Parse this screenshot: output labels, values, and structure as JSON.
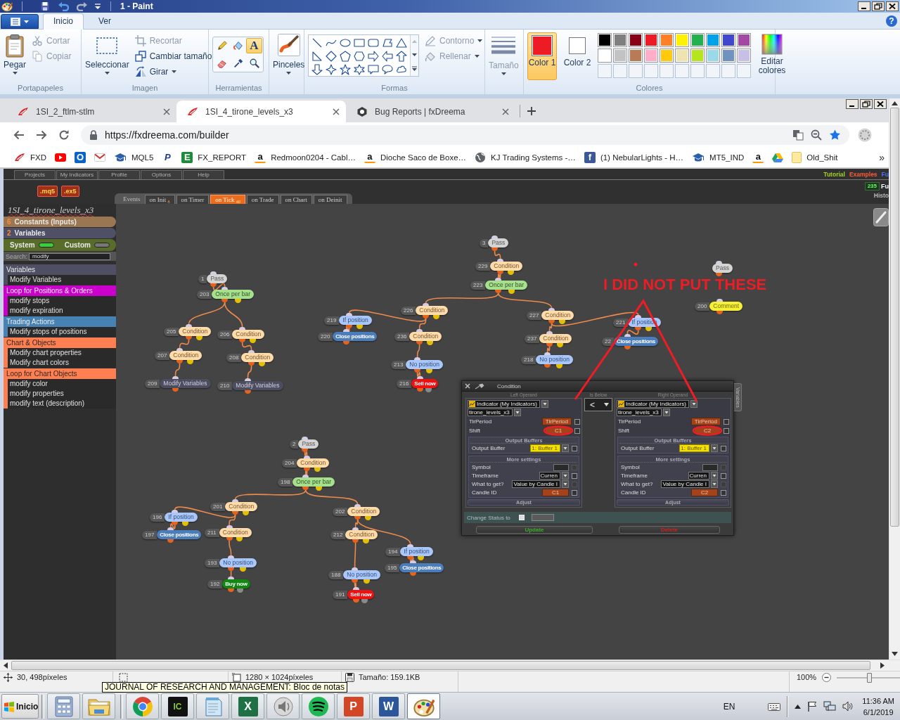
{
  "paint": {
    "title": "1 - Paint",
    "help": "?",
    "tabs": [
      {
        "label": "Inicio",
        "selected": true
      },
      {
        "label": "Ver",
        "selected": false
      }
    ],
    "clipboard": {
      "label": "Portapapeles",
      "paste": "Pegar",
      "actions": [
        {
          "label": "Cortar",
          "disabled": true
        },
        {
          "label": "Copiar",
          "disabled": true
        }
      ]
    },
    "image": {
      "label": "Imagen",
      "select": "Seleccionar",
      "actions": [
        {
          "label": "Recortar",
          "disabled": true
        },
        {
          "label": "Cambiar tamaño",
          "disabled": false
        },
        {
          "label": "Girar",
          "disabled": false
        }
      ]
    },
    "tools": {
      "label": "Herramientas",
      "items": [
        {
          "kind": "pencil",
          "selected": false
        },
        {
          "kind": "fill",
          "selected": false
        },
        {
          "kind": "text",
          "glyph": "A",
          "selected": true
        },
        {
          "kind": "eraser",
          "selected": false
        },
        {
          "kind": "picker",
          "selected": false
        },
        {
          "kind": "magnifier",
          "selected": false
        }
      ]
    },
    "brushes": {
      "label": "Pinceles"
    },
    "shapes": {
      "label": "Formas",
      "options": [
        {
          "label": "Contorno",
          "disabled": true
        },
        {
          "label": "Rellenar",
          "disabled": true
        }
      ]
    },
    "size": {
      "label": "Tamaño",
      "disabled": true
    },
    "colors": {
      "label": "Colores",
      "slots": [
        {
          "label": "Color 1",
          "color": "#ed1c24",
          "selected": true
        },
        {
          "label": "Color 2",
          "color": "#ffffff",
          "selected": false
        }
      ],
      "palette": [
        {
          "color": "#000000"
        },
        {
          "color": "#7f7f7f"
        },
        {
          "color": "#880015"
        },
        {
          "color": "#ed1c24"
        },
        {
          "color": "#ff7f27"
        },
        {
          "color": "#fff200"
        },
        {
          "color": "#22b14c"
        },
        {
          "color": "#00a2e8"
        },
        {
          "color": "#3f48cc"
        },
        {
          "color": "#a349a4"
        },
        {
          "color": "#ffffff"
        },
        {
          "color": "#c3c3c3"
        },
        {
          "color": "#b97a57"
        },
        {
          "color": "#ffaec9"
        },
        {
          "color": "#ffc90e"
        },
        {
          "color": "#efe4b0"
        },
        {
          "color": "#b5e61d"
        },
        {
          "color": "#99d9ea"
        },
        {
          "color": "#7092be"
        },
        {
          "color": "#c8bfe7"
        }
      ],
      "edit": "Editar colores"
    },
    "status": {
      "position": "30, 498píxeles",
      "dimensions": "1280 × 1024píxeles",
      "file_size": "Tamaño: 159.1KB",
      "zoom": "100%",
      "zoom_slider": {
        "level": 0.5
      }
    }
  },
  "browser": {
    "tabs": [
      {
        "title": "1SI_2_ftlm-stlm",
        "kind": "fxd",
        "selected": false
      },
      {
        "title": "1SI_4_tirone_levels_x3",
        "kind": "fxd",
        "selected": true
      },
      {
        "title": "Bug Reports | fxDreema",
        "kind": "hexagon",
        "selected": false
      }
    ],
    "address": "https://fxdreema.com/builder",
    "bookmarks": [
      {
        "label": "FXD",
        "kind": "fxd"
      },
      {
        "kind": "video"
      },
      {
        "kind": "mail",
        "glyph": "O"
      },
      {
        "kind": "envelope"
      },
      {
        "label": "MQL5",
        "kind": "mortarboard"
      },
      {
        "kind": "pay",
        "glyph": "P"
      },
      {
        "label": "FX_REPORT",
        "kind": "report",
        "glyph": "E"
      },
      {
        "label": "Redmoon0204 - Cabl…",
        "kind": "shop",
        "glyph": "a"
      },
      {
        "label": "Dioche Saco de Boxe…",
        "kind": "shop",
        "glyph": "a"
      },
      {
        "label": "KJ Trading Systems -…",
        "kind": "globe"
      },
      {
        "label": "(1) NebularLights - H…",
        "kind": "social",
        "glyph": "f"
      },
      {
        "label": "MT5_IND",
        "kind": "mortarboard"
      },
      {
        "kind": "shop",
        "glyph": "a"
      },
      {
        "kind": "drive"
      },
      {
        "label": "Old_Shit",
        "kind": "note"
      }
    ],
    "more_bookmarks": "»"
  },
  "app": {
    "menu": [
      "Projects",
      "My Indicators",
      "Profile",
      "Options",
      "Help"
    ],
    "links": [
      {
        "label": "Tutorial",
        "color": "#a6d222"
      },
      {
        "label": "Examples",
        "color": "#ff5a36"
      },
      {
        "label": "Fu",
        "color": "#4a74ff"
      }
    ],
    "exports": [
      ".mq5",
      ".ex5"
    ],
    "events_label": "Events",
    "events": [
      {
        "label": "on Init",
        "count": "8",
        "selected": false
      },
      {
        "label": "on Timer",
        "selected": false
      },
      {
        "label": "on Tick",
        "count": "40",
        "selected": true
      },
      {
        "label": "on Trade",
        "selected": false
      },
      {
        "label": "on Chart",
        "selected": false
      },
      {
        "label": "on Deinit",
        "selected": false
      }
    ],
    "counter": "235",
    "counter_label": "Fu",
    "history": "Histo",
    "project": "1SI_4_tirone_levels_x3",
    "constants": {
      "count": "6",
      "label": "Constants (Inputs)"
    },
    "variables": {
      "count": "2",
      "label": "Variables"
    },
    "toggles": [
      {
        "label": "System",
        "on": true
      },
      {
        "label": "Custom",
        "on": false
      }
    ],
    "search": {
      "label": "Search:",
      "value": "modify"
    },
    "categories": [
      {
        "title": "Variables",
        "color": "#4f4f63",
        "items": [
          "Modify Variables"
        ]
      },
      {
        "title": "Loop for Positions & Orders",
        "color": "#cc00cc",
        "items": [
          "modify stops",
          "modify expiration"
        ]
      },
      {
        "title": "Trading Actions",
        "color": "#4682b4",
        "items": [
          "Modify stops of positions"
        ]
      },
      {
        "title": "Chart & Objects",
        "color": "#ff7f50",
        "items": [
          "Modify chart properties",
          "Modify chart colors"
        ]
      },
      {
        "title": "Loop for Chart Objects",
        "color": "#ff7f50",
        "items": [
          "modify color",
          "modify properties",
          "modify text (description)"
        ]
      }
    ],
    "flows": [
      {
        "number": "1",
        "label": "Pass",
        "kind": "pass",
        "children": [
          {
            "number": "203",
            "label": "Once per bar",
            "kind": "once",
            "children": [
              {
                "number": "205",
                "label": "Condition",
                "kind": "condition",
                "children": [
                  {
                    "number": "207",
                    "label": "Condition",
                    "kind": "condition",
                    "children": [
                      {
                        "number": "209",
                        "label": "Modify Variables",
                        "kind": "modify_variables"
                      }
                    ]
                  }
                ]
              },
              {
                "number": "206",
                "label": "Condition",
                "kind": "condition",
                "children": [
                  {
                    "number": "208",
                    "label": "Condition",
                    "kind": "condition",
                    "children": [
                      {
                        "number": "210",
                        "label": "Modify Variables",
                        "kind": "modify_variables"
                      }
                    ]
                  }
                ]
              }
            ]
          }
        ]
      },
      {
        "number": "3",
        "label": "Pass",
        "kind": "pass",
        "children": [
          {
            "number": "229",
            "label": "Condition",
            "kind": "condition",
            "children": [
              {
                "number": "223",
                "label": "Once per bar",
                "kind": "once",
                "children": [
                  {
                    "number": "226",
                    "label": "Condition",
                    "kind": "condition",
                    "children": [
                      {
                        "number": "219",
                        "label": "If position",
                        "kind": "if_position",
                        "children": [
                          {
                            "number": "220",
                            "label": "Close positions",
                            "kind": "close_positions"
                          }
                        ]
                      },
                      {
                        "number": "236",
                        "label": "Condition",
                        "kind": "condition",
                        "children": [
                          {
                            "number": "213",
                            "label": "No position",
                            "kind": "no_position",
                            "children": [
                              {
                                "number": "216",
                                "label": "Sell now",
                                "kind": "sell"
                              }
                            ]
                          }
                        ]
                      }
                    ]
                  },
                  {
                    "number": "227",
                    "label": "Condition",
                    "kind": "condition",
                    "children": [
                      {
                        "number": "237",
                        "label": "Condition",
                        "kind": "condition",
                        "children": [
                          {
                            "number": "218",
                            "label": "No position",
                            "kind": "no_position"
                          }
                        ]
                      },
                      {
                        "number": "221",
                        "label": "If position",
                        "kind": "if_position",
                        "children": [
                          {
                            "number": "22",
                            "label": "Close positions",
                            "kind": "close_positions"
                          }
                        ]
                      }
                    ]
                  }
                ]
              }
            ]
          }
        ]
      },
      {
        "label": "Pass",
        "kind": "pass"
      },
      {
        "number": "200",
        "label": "Comment",
        "kind": "comment"
      },
      {
        "number": "2",
        "label": "Pass",
        "kind": "pass",
        "children": [
          {
            "number": "204",
            "label": "Condition",
            "kind": "condition",
            "children": [
              {
                "number": "198",
                "label": "Once per bar",
                "kind": "once",
                "children": [
                  {
                    "number": "201",
                    "label": "Condition",
                    "kind": "condition",
                    "children": [
                      {
                        "number": "196",
                        "label": "If position",
                        "kind": "if_position",
                        "children": [
                          {
                            "number": "197",
                            "label": "Close positions",
                            "kind": "close_positions"
                          }
                        ]
                      },
                      {
                        "number": "211",
                        "label": "Condition",
                        "kind": "condition",
                        "children": [
                          {
                            "number": "193",
                            "label": "No position",
                            "kind": "no_position",
                            "children": [
                              {
                                "number": "192",
                                "label": "Buy now",
                                "kind": "buy"
                              }
                            ]
                          }
                        ]
                      }
                    ]
                  },
                  {
                    "number": "202",
                    "label": "Condition",
                    "kind": "condition",
                    "children": [
                      {
                        "number": "212",
                        "label": "Condition",
                        "kind": "condition",
                        "children": [
                          {
                            "number": "188",
                            "label": "No position",
                            "kind": "no_position",
                            "children": [
                              {
                                "number": "191",
                                "label": "Sell now",
                                "kind": "sell"
                              }
                            ]
                          }
                        ]
                      },
                      {
                        "number": "194",
                        "label": "If position",
                        "kind": "if_position",
                        "children": [
                          {
                            "number": "195",
                            "label": "Close positions",
                            "kind": "close_positions"
                          }
                        ]
                      }
                    ]
                  }
                ]
              }
            ]
          }
        ]
      }
    ],
    "annotation": {
      "text": "I DID NOT PUT THESE"
    },
    "dialog": {
      "title": "Condition",
      "side_tab": "Variables",
      "operator_heading": "Is Below",
      "operator": "<",
      "operands": [
        {
          "heading": "Left Operand",
          "source": "Indicator (My Indicators)",
          "indicator": "tirone_levels_x3",
          "params": [
            {
              "label": "TirPeriod",
              "value": "TirPeriod",
              "checked": false
            },
            {
              "label": "Shift",
              "value": "C1",
              "checked": false
            }
          ],
          "buffers_heading": "Output Buffers",
          "buffer_label": "Output Buffer",
          "buffer": "1: Buffer 1",
          "buffer_checked": false,
          "more_heading": "More settings",
          "settings": [
            {
              "label": "Symbol",
              "kind": "text",
              "checked": false,
              "disabled": true
            },
            {
              "label": "Timeframe",
              "kind": "select",
              "value": "Curren",
              "checked": false,
              "disabled": false
            },
            {
              "label": "What to get?",
              "kind": "select",
              "value": "Value by Candle I",
              "checked": false,
              "disabled": true
            },
            {
              "label": "Candle ID",
              "kind": "variable",
              "value": "C1",
              "checked": false,
              "disabled": false
            }
          ],
          "adjust": "Adjust"
        },
        {
          "heading": "Right Operand",
          "source": "Indicator (My Indicators)",
          "indicator": "tirone_levels_x3",
          "params": [
            {
              "label": "TirPeriod",
              "value": "TirPeriod",
              "checked": false
            },
            {
              "label": "Shift",
              "value": "C2",
              "checked": false
            }
          ],
          "buffers_heading": "Output Buffers",
          "buffer_label": "Output Buffer",
          "buffer": "1: Buffer 1",
          "buffer_checked": false,
          "more_heading": "More settings",
          "settings": [
            {
              "label": "Symbol",
              "kind": "text",
              "checked": false,
              "disabled": true
            },
            {
              "label": "Timeframe",
              "kind": "select",
              "value": "Curren",
              "checked": false,
              "disabled": false
            },
            {
              "label": "What to get?",
              "kind": "select",
              "value": "Value by Candle I",
              "checked": false,
              "disabled": true
            },
            {
              "label": "Candle ID",
              "kind": "variable",
              "value": "C2",
              "checked": false,
              "disabled": false
            }
          ],
          "adjust": "Adjust"
        }
      ],
      "status_label": "Change Status to",
      "status_checked": false,
      "buttons": [
        {
          "label": "Update",
          "kind": "update"
        },
        {
          "label": "Delete",
          "kind": "delete"
        }
      ]
    }
  },
  "taskbar": {
    "start": "Inicio",
    "apps": [
      {
        "kind": "calculator",
        "selected": false
      },
      {
        "kind": "folder",
        "selected": false
      },
      {
        "kind": "browser",
        "selected": false
      },
      {
        "kind": "chart",
        "glyph": "IC",
        "selected": false
      },
      {
        "kind": "notepad",
        "selected": false
      },
      {
        "kind": "spreadsheet",
        "glyph": "X",
        "selected": false
      },
      {
        "kind": "speaker",
        "selected": false
      },
      {
        "kind": "music",
        "selected": false
      },
      {
        "kind": "slides",
        "glyph": "P",
        "selected": false
      },
      {
        "kind": "document",
        "glyph": "W",
        "selected": false
      },
      {
        "kind": "paint",
        "selected": true
      }
    ],
    "tooltip": "JOURNAL OF RESEARCH AND MANAGEMENT: Bloc de notas",
    "language": "EN",
    "time": "11:36 AM",
    "date": "6/1/2019"
  }
}
